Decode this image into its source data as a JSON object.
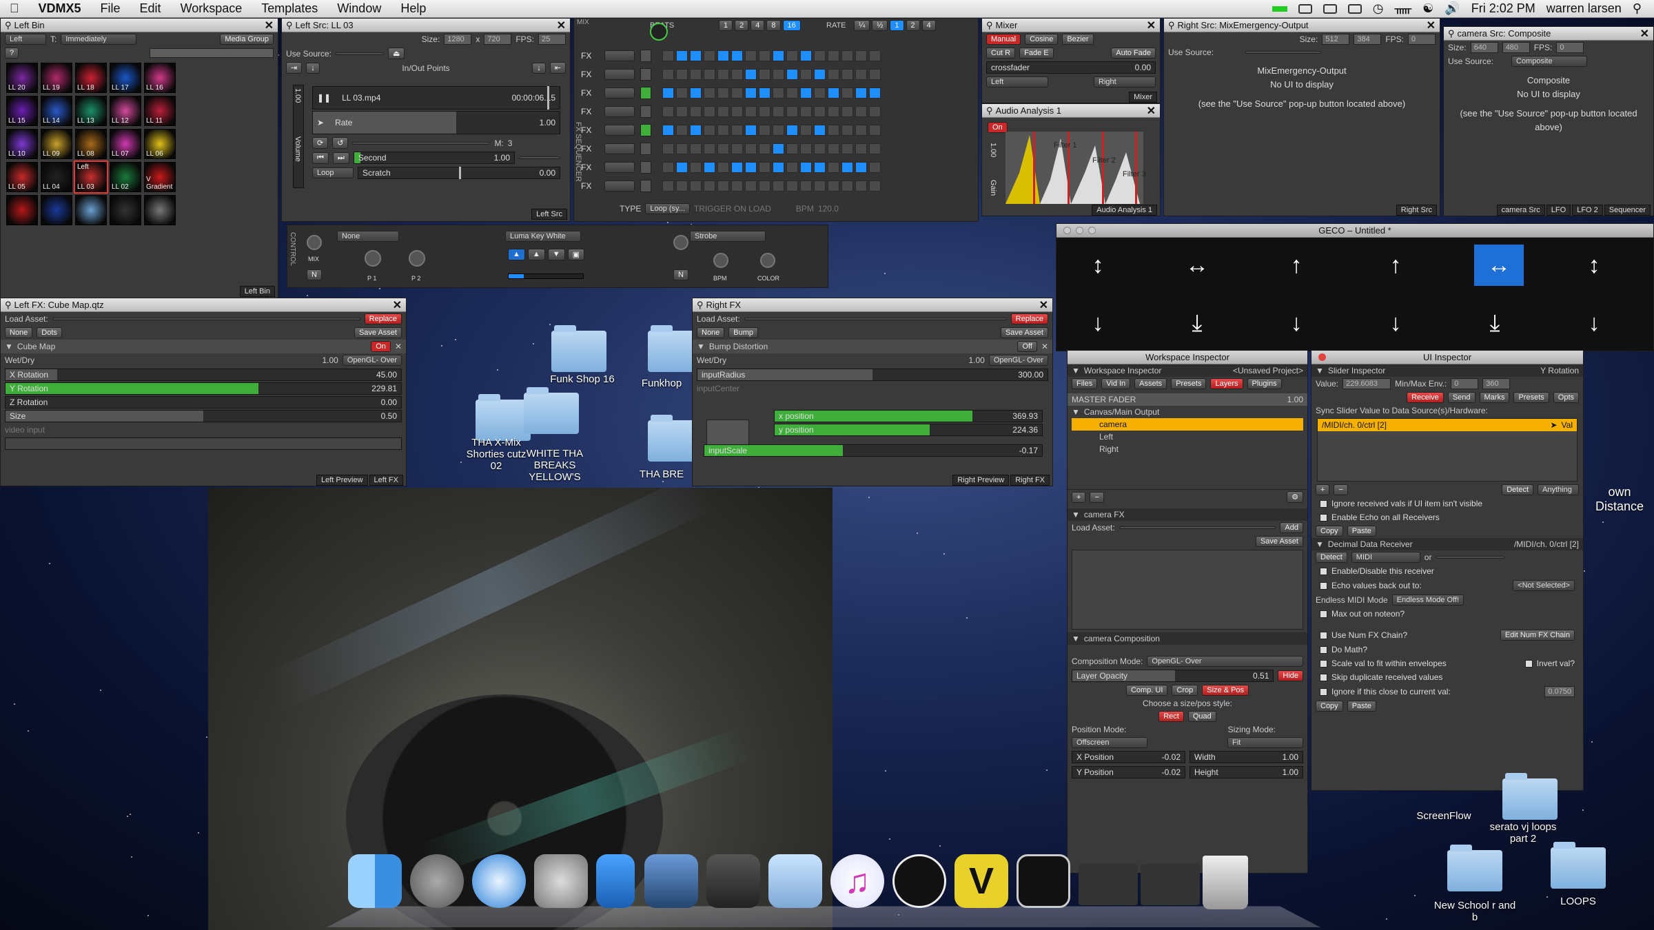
{
  "menubar": {
    "app": "VDMX5",
    "items": [
      "File",
      "Edit",
      "Workspace",
      "Templates",
      "Window",
      "Help"
    ],
    "clock": "Fri 2:02 PM",
    "user": "warren larsen"
  },
  "left_bin": {
    "title": "Left Bin",
    "layer": "Left",
    "trigger_label": "T:",
    "trigger_mode": "Immediately",
    "media_group": "Media Group",
    "tab": "Left Bin",
    "clips": [
      "LL 20",
      "LL 19",
      "LL 18",
      "LL 17",
      "LL 16",
      "LL 15",
      "LL 14",
      "LL 13",
      "LL 12",
      "LL 11",
      "LL 10",
      "LL 09",
      "LL 08",
      "LL 07",
      "LL 06",
      "LL 05",
      "LL 04",
      "LL 03",
      "LL 02",
      "V Gradient",
      "",
      "",
      "",
      "",
      ""
    ],
    "active_label": "Left"
  },
  "left_src": {
    "title": "Left Src: LL 03",
    "size_label": "Size:",
    "w": "1280",
    "x": "x",
    "h": "720",
    "fps_label": "FPS:",
    "fps": "25",
    "use_source": "Use Source:",
    "inout": "In/Out Points",
    "file": "LL 03.mp4",
    "time": "00:00:06.15",
    "rate_label": "Rate",
    "rate": "1.00",
    "second_label": "Second",
    "second_val": "1.00",
    "m_label": "M:",
    "m_val": "3",
    "loop": "Loop",
    "scratch": "Scratch",
    "scratch_val": "0.00",
    "volume": "Volume",
    "vol_val": "1.00",
    "tab": "Left Src"
  },
  "sequencer": {
    "mix": "MIX",
    "beats": "BEATS",
    "beat_vals": [
      "1",
      "2",
      "4",
      "8",
      "16"
    ],
    "rate": "RATE",
    "rate_vals": [
      "¼",
      "½",
      "1",
      "2",
      "4"
    ],
    "fx": "FX",
    "type_label": "TYPE",
    "type": "Loop (sy...",
    "trigger": "TRIGGER ON LOAD",
    "bpm": "BPM",
    "bpm_val": "120.0",
    "side": "FX SEQUENCER",
    "rows": [
      [
        0,
        1,
        1,
        0,
        1,
        1,
        0,
        0,
        1,
        0,
        1,
        0,
        0,
        0,
        0,
        0
      ],
      [
        0,
        0,
        0,
        0,
        0,
        0,
        1,
        0,
        0,
        1,
        0,
        1,
        0,
        0,
        0,
        0
      ],
      [
        1,
        0,
        1,
        0,
        0,
        0,
        1,
        1,
        0,
        0,
        1,
        0,
        1,
        0,
        1,
        1
      ],
      [
        0,
        0,
        0,
        0,
        0,
        0,
        0,
        0,
        0,
        0,
        0,
        0,
        0,
        0,
        0,
        0
      ],
      [
        1,
        0,
        1,
        0,
        0,
        0,
        1,
        0,
        0,
        1,
        0,
        1,
        0,
        0,
        0,
        0
      ],
      [
        0,
        0,
        0,
        0,
        0,
        0,
        0,
        0,
        1,
        0,
        0,
        0,
        0,
        0,
        0,
        0
      ],
      [
        0,
        1,
        0,
        1,
        0,
        1,
        1,
        0,
        1,
        0,
        1,
        1,
        0,
        1,
        1,
        0
      ],
      [
        0,
        0,
        0,
        0,
        0,
        0,
        0,
        0,
        0,
        0,
        0,
        0,
        0,
        0,
        0,
        0
      ]
    ]
  },
  "mixer": {
    "title": "Mixer",
    "modes": [
      "Manual",
      "Cosine",
      "Bezier"
    ],
    "cutr": "Cut R",
    "fadee": "Fade E",
    "autofade": "Auto Fade",
    "crossfader": "crossfader",
    "cf_val": "0.00",
    "left": "Left",
    "right": "Right",
    "tab": "Mixer"
  },
  "audio": {
    "title": "Audio Analysis 1",
    "on": "On",
    "gain": "Gain",
    "gain_val": "1.00",
    "filters": [
      "Filter 1",
      "Filter 2",
      "Filter 3"
    ],
    "tab": "Audio Analysis 1"
  },
  "right_src": {
    "title": "Right Src: MixEmergency-Output",
    "size_label": "Size:",
    "w": "512",
    "h": "384",
    "fps_label": "FPS:",
    "fps": "0",
    "use_source": "Use Source:",
    "name": "MixEmergency-Output",
    "noui": "No UI to display",
    "hint": "(see the \"Use Source\" pop-up button located above)",
    "tab": "Right Src"
  },
  "camera_src": {
    "title": "camera Src: Composite",
    "size_label": "Size:",
    "w": "640",
    "h": "480",
    "fps_label": "FPS:",
    "fps": "0",
    "use_source": "Use Source:",
    "source": "Composite",
    "name": "Composite",
    "noui": "No UI to display",
    "hint": "(see the \"Use Source\" pop-up button located above)",
    "tabs": [
      "camera Src",
      "LFO",
      "LFO 2",
      "Sequencer"
    ]
  },
  "controls": {
    "side": "CONTROL",
    "left_fx": "None",
    "mid_fx": "Luma Key White",
    "right_fx": "Strobe",
    "mix": "MIX",
    "p1": "P 1",
    "p2": "P 2",
    "bpm": "BPM",
    "color": "COLOR",
    "n": "N"
  },
  "left_fx": {
    "title": "Left FX: Cube Map.qtz",
    "load_asset": "Load Asset:",
    "replace": "Replace",
    "none": "None",
    "dots": "Dots",
    "save": "Save Asset",
    "effect": "Cube Map",
    "on": "On",
    "wetdry": "Wet/Dry",
    "wetdry_val": "1.00",
    "blend": "OpenGL- Over",
    "params": [
      {
        "name": "X Rotation",
        "val": "45.00",
        "pct": 0.13,
        "green": false
      },
      {
        "name": "Y Rotation",
        "val": "229.81",
        "pct": 0.64,
        "green": true
      },
      {
        "name": "Z Rotation",
        "val": "0.00",
        "pct": 0,
        "green": false
      },
      {
        "name": "Size",
        "val": "0.50",
        "pct": 0.5,
        "green": false
      }
    ],
    "video_input": "video input",
    "tabs": [
      "Left Preview",
      "Left FX"
    ]
  },
  "right_fx": {
    "title": "Right FX",
    "load_asset": "Load Asset:",
    "replace": "Replace",
    "none": "None",
    "bump": "Bump",
    "save": "Save Asset",
    "effect": "Bump Distortion",
    "off": "Off",
    "wetdry": "Wet/Dry",
    "wetdry_val": "1.00",
    "blend": "OpenGL- Over",
    "radius": "inputRadius",
    "radius_val": "300.00",
    "center": "inputCenter",
    "xpos": "x position",
    "xpos_val": "369.93",
    "ypos": "y position",
    "ypos_val": "224.36",
    "scale": "inputScale",
    "scale_val": "-0.17",
    "tabs": [
      "Right Preview",
      "Right FX"
    ]
  },
  "desktop": {
    "items": [
      "Funk Shop 16",
      "Funkhop",
      "THA X-Mix Shorties cutz 02",
      "WHITE THA BREAKS YELLOW'S",
      "THA BRE"
    ],
    "right_items": [
      "ScreenFlow",
      "serato vj loops part 2",
      "New School r and b",
      "LOOPS"
    ],
    "distance": "own Distance"
  },
  "geco": {
    "title": "GECO – Untitled *"
  },
  "workspace": {
    "title": "Workspace Inspector",
    "header": "Workspace Inspector",
    "project": "<Unsaved Project>",
    "tabs": [
      "Files",
      "Vid In",
      "Assets",
      "Presets",
      "Layers",
      "Plugins"
    ],
    "master": "MASTER FADER",
    "master_val": "1.00",
    "group": "Canvas/Main Output",
    "layers": [
      "camera",
      "Left",
      "Right"
    ],
    "camfx": "camera FX",
    "load_asset": "Load Asset:",
    "add": "Add",
    "save": "Save Asset",
    "comp": "camera Composition",
    "comp_mode": "Composition Mode:",
    "comp_mode_val": "OpenGL- Over",
    "opacity": "Layer Opacity",
    "opacity_val": "0.51",
    "hide": "Hide",
    "subtabs": [
      "Comp. UI",
      "Crop",
      "Size & Pos"
    ],
    "style": "Choose a size/pos style:",
    "rect": "Rect",
    "quad": "Quad",
    "posmode": "Position Mode:",
    "posmode_val": "Offscreen",
    "sizemode": "Sizing Mode:",
    "sizemode_val": "Fit",
    "xpos": "X Position",
    "xpos_val": "-0.02",
    "ypos": "Y Position",
    "ypos_val": "-0.02",
    "width": "Width",
    "width_val": "1.00",
    "height": "Height",
    "height_val": "1.00"
  },
  "ui_inspector": {
    "title": "UI Inspector",
    "header": "Slider Inspector",
    "target": "Y Rotation",
    "value_label": "Value:",
    "value": "229.6083",
    "minmax": "Min/Max Env.:",
    "min": "0",
    "max": "360",
    "tabs": [
      "Receive",
      "Send",
      "Marks",
      "Presets",
      "Opts"
    ],
    "sync": "Sync Slider Value to Data Source(s)/Hardware:",
    "source": "/MIDI/ch. 0/ctrl [2]",
    "val": "Val",
    "detect": "Detect",
    "anything": "Anything",
    "ignore": "Ignore received vals if UI item isn't visible",
    "echo": "Enable Echo on all Receivers",
    "copy": "Copy",
    "paste": "Paste",
    "ddr": "Decimal Data Receiver",
    "ddr_src": "/MIDI/ch. 0/ctrl [2]",
    "midi": "MIDI",
    "or": "or",
    "enable": "Enable/Disable this receiver",
    "echoout": "Echo values back out to:",
    "notsel": "<Not Selected>",
    "endless": "Endless MIDI Mode",
    "endless_val": "Endless Mode Off!",
    "maxout": "Max out on noteon?",
    "numfx": "Use Num FX Chain?",
    "editfx": "Edit Num FX Chain",
    "domath": "Do Math?",
    "scale": "Scale val to fit within envelopes",
    "invert": "Invert val?",
    "skip": "Skip duplicate received values",
    "close": "Ignore if this close to current val:",
    "close_val": "0.0750"
  },
  "colors": {
    "accent_blue": "#1f8fff",
    "green": "#3fae3a",
    "red": "#c92828",
    "highlight": "#f5b000"
  }
}
